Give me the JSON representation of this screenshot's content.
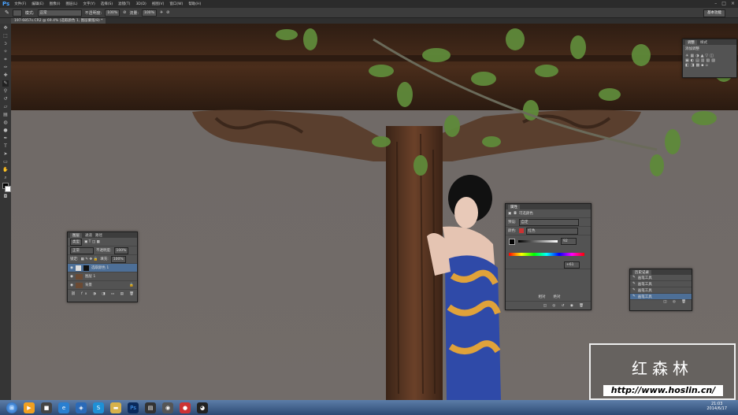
{
  "menubar": {
    "logo": "Ps",
    "items": [
      "文件(F)",
      "编辑(E)",
      "图像(I)",
      "图层(L)",
      "文字(Y)",
      "选择(S)",
      "滤镜(T)",
      "3D(D)",
      "视图(V)",
      "窗口(W)",
      "帮助(H)"
    ]
  },
  "options": {
    "mode_label": "模式:",
    "mode_value": "正常",
    "opacity_label": "不透明度:",
    "opacity_value": "100%",
    "flow_label": "流量:",
    "flow_value": "100%",
    "workspace": "基本功能"
  },
  "document_tab": "197-6857s.CR2 @ 69.4% (选取颜色 1, 图层蒙版/8) *",
  "layers_panel": {
    "tabs": [
      "图层",
      "通道",
      "路径"
    ],
    "kind": "类型",
    "blend_mode": "正常",
    "opacity_label": "不透明度:",
    "opacity_value": "100%",
    "lock_label": "锁定:",
    "fill_label": "填充:",
    "fill_value": "100%",
    "layers": [
      "选取颜色 1",
      "图层 1",
      "背景"
    ]
  },
  "properties_panel": {
    "tab": "属性",
    "title": "可选颜色",
    "preset_label": "预设:",
    "preset_value": "自定",
    "colors_label": "颜色:",
    "colors_value": "红色",
    "value": "92",
    "value2": "+61",
    "method_relative": "相对",
    "method_absolute": "绝对"
  },
  "adjustments_panel": {
    "tabs": [
      "调整",
      "样式"
    ],
    "title": "添加调整"
  },
  "history_panel": {
    "tab": "历史记录",
    "items": [
      "画笔工具",
      "画笔工具",
      "画笔工具",
      "画笔工具"
    ]
  },
  "taskbar": {
    "clock_time": "21:03",
    "clock_date": "2014/6/17"
  },
  "watermark": {
    "name": "红森林",
    "url": "http://www.hoslin.cn/"
  }
}
